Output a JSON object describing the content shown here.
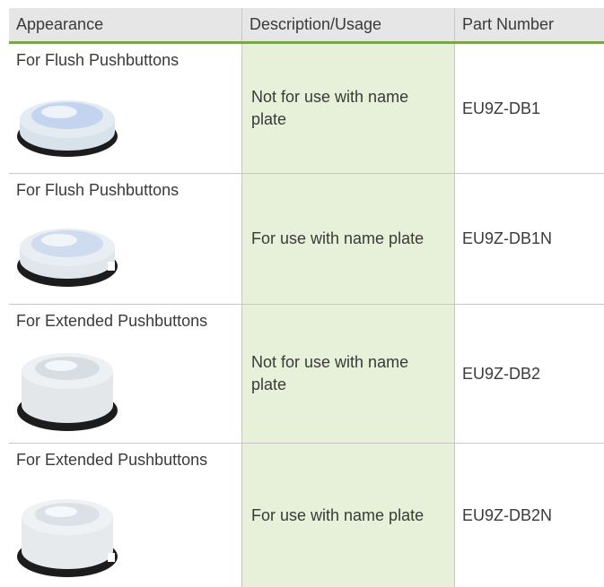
{
  "table": {
    "headers": {
      "appearance": "Appearance",
      "description": "Description/Usage",
      "part_number": "Part Number"
    },
    "rows": [
      {
        "appearance": "For Flush Pushbuttons",
        "description": "Not for use with name plate",
        "part_number": "EU9Z-DB1",
        "image": "flush-cap-image"
      },
      {
        "appearance": "For Flush Pushbuttons",
        "description": "For use with name plate",
        "part_number": "EU9Z-DB1N",
        "image": "flush-cap-notched-image"
      },
      {
        "appearance": "For Extended Pushbuttons",
        "description": "Not for use with name plate",
        "part_number": "EU9Z-DB2",
        "image": "extended-cap-image"
      },
      {
        "appearance": "For Extended Pushbuttons",
        "description": "For use with name plate",
        "part_number": "EU9Z-DB2N",
        "image": "extended-cap-notched-image"
      }
    ]
  },
  "colors": {
    "header_bg": "#e6e6e6",
    "header_rule": "#7aa54a",
    "description_bg": "#e7f0d8",
    "text": "#3a3a3a"
  }
}
